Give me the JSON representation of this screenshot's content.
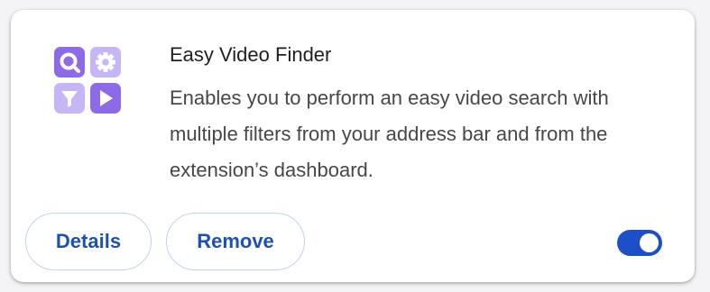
{
  "extension": {
    "icon": "easy-video-finder-logo-icon",
    "name": "Easy Video Finder",
    "description": "Enables you to perform an easy video search with multiple filters from your address bar and from the extension’s dashboard."
  },
  "actions": {
    "details_label": "Details",
    "remove_label": "Remove"
  },
  "toggle": {
    "enabled": true
  },
  "colors": {
    "accent": "#1d50c8",
    "button_text": "#1d50b4",
    "button_border": "#c3d2ef",
    "icon_purple_dark": "#8e6be6",
    "icon_purple_light": "#c7b6f5"
  }
}
